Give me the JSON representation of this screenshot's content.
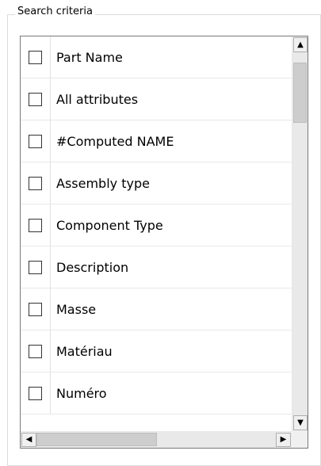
{
  "group_title": "Search criteria",
  "items": [
    {
      "label": "Part Name",
      "checked": false
    },
    {
      "label": "All attributes",
      "checked": false
    },
    {
      "label": "#Computed NAME",
      "checked": false
    },
    {
      "label": "Assembly type",
      "checked": false
    },
    {
      "label": "Component Type",
      "checked": false
    },
    {
      "label": "Description",
      "checked": false
    },
    {
      "label": "Masse",
      "checked": false
    },
    {
      "label": "Matériau",
      "checked": false
    },
    {
      "label": "Numéro",
      "checked": false
    }
  ],
  "icons": {
    "scroll_up": "▲",
    "scroll_down": "▼",
    "scroll_left": "◀",
    "scroll_right": "▶"
  }
}
